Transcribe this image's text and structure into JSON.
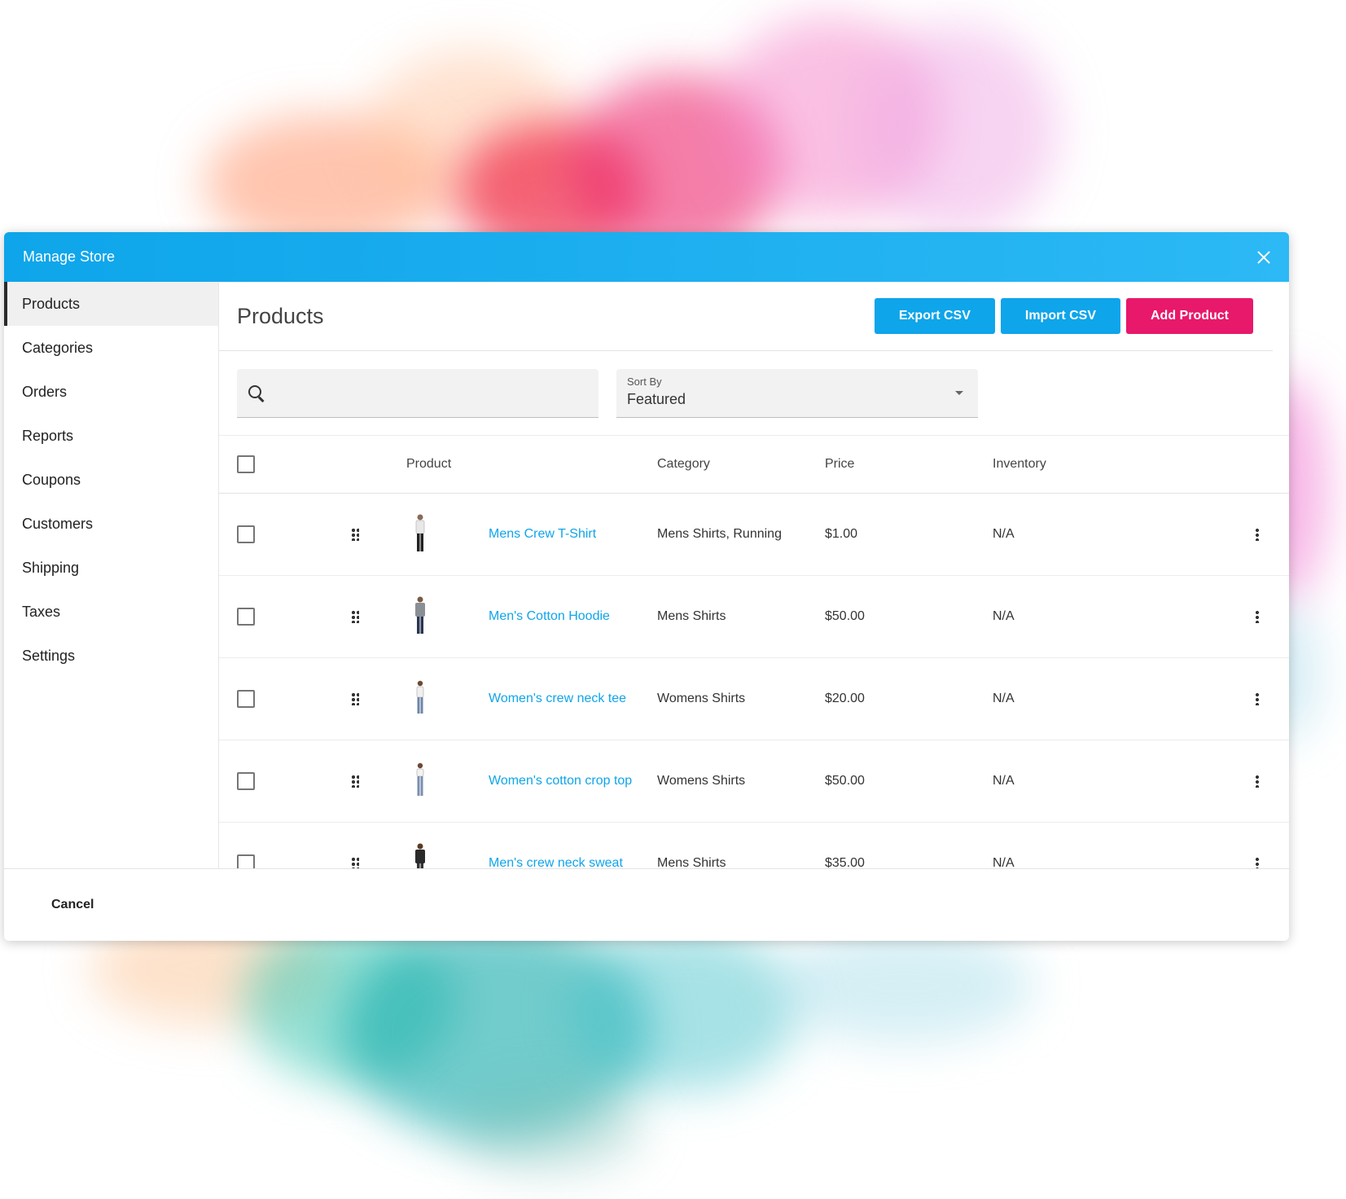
{
  "window": {
    "title": "Manage Store"
  },
  "sidebar": {
    "items": [
      {
        "label": "Products",
        "active": true
      },
      {
        "label": "Categories"
      },
      {
        "label": "Orders"
      },
      {
        "label": "Reports"
      },
      {
        "label": "Coupons"
      },
      {
        "label": "Customers"
      },
      {
        "label": "Shipping"
      },
      {
        "label": "Taxes"
      },
      {
        "label": "Settings"
      }
    ]
  },
  "main": {
    "title": "Products",
    "export_label": "Export CSV",
    "import_label": "Import CSV",
    "add_label": "Add Product"
  },
  "filters": {
    "search_value": "",
    "sort_label": "Sort By",
    "sort_value": "Featured"
  },
  "table": {
    "columns": [
      "Product",
      "Category",
      "Price",
      "Inventory"
    ],
    "rows": [
      {
        "name": "Mens Crew T-Shirt",
        "category": "Mens Shirts, Running",
        "price": "$1.00",
        "inventory": "N/A"
      },
      {
        "name": "Men's Cotton Hoodie",
        "category": "Mens Shirts",
        "price": "$50.00",
        "inventory": "N/A"
      },
      {
        "name": "Women's crew neck tee",
        "category": "Womens Shirts",
        "price": "$20.00",
        "inventory": "N/A"
      },
      {
        "name": "Women's cotton crop top",
        "category": "Womens Shirts",
        "price": "$50.00",
        "inventory": "N/A"
      },
      {
        "name": "Men's crew neck sweat",
        "category": "Mens Shirts",
        "price": "$35.00",
        "inventory": "N/A"
      }
    ]
  },
  "footer": {
    "cancel_label": "Cancel"
  },
  "colors": {
    "accent": "#0ea5ea",
    "primary_action": "#e8186a",
    "link": "#0ea5ea"
  },
  "icons": [
    "close-icon",
    "search-icon",
    "caret-down-icon",
    "drag-handle-icon",
    "more-vertical-icon"
  ]
}
